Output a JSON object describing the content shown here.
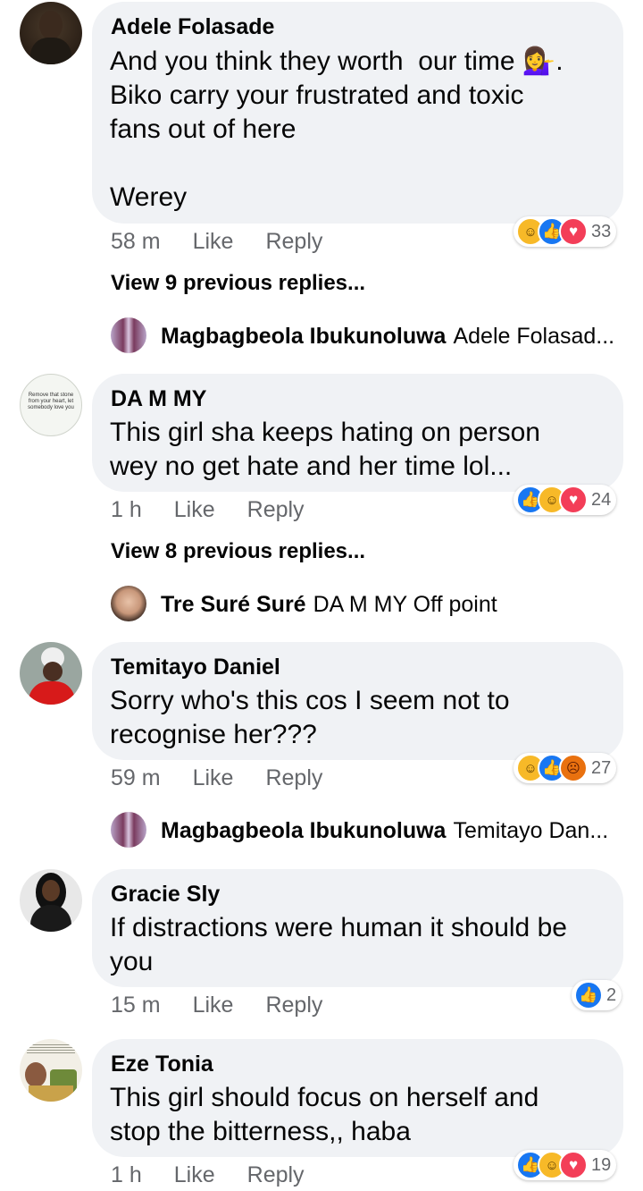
{
  "actions": {
    "like": "Like",
    "reply": "Reply"
  },
  "comments": [
    {
      "name": "Adele Folasade",
      "text": "And you think they worth  our time 💁‍♀️.\nBiko carry your frustrated and toxic\nfans out of here\n\nWerey",
      "time": "58 m",
      "reaction_count": "33",
      "reactions": [
        "haha-icon",
        "like-icon",
        "love-icon"
      ],
      "view_replies": "View 9 previous replies...",
      "reply_preview": {
        "name": "Magbagbeola Ibukunoluwa",
        "text": "Adele Folasad..."
      }
    },
    {
      "name": "DA M MY",
      "avatar_text": "Remove that stone from your heart, let somebody love you",
      "text": "This girl sha keeps hating on person\nwey no get hate and her time lol...",
      "time": "1 h",
      "reaction_count": "24",
      "reactions": [
        "like-icon",
        "haha-icon",
        "love-icon"
      ],
      "view_replies": "View 8 previous replies...",
      "reply_preview": {
        "name": "Tre Suré Suré",
        "text": "DA M MY Off point"
      }
    },
    {
      "name": "Temitayo Daniel",
      "text": "Sorry who's this cos I seem not to\nrecognise her???",
      "time": "59 m",
      "reaction_count": "27",
      "reactions": [
        "haha-icon",
        "like-icon",
        "angry-icon"
      ],
      "reply_preview": {
        "name": "Magbagbeola Ibukunoluwa",
        "text": "Temitayo Dan..."
      }
    },
    {
      "name": "Gracie Sly",
      "text": "If distractions were human it should be\nyou",
      "time": "15 m",
      "reaction_count": "2",
      "reactions": [
        "like-icon"
      ]
    },
    {
      "name": "Eze Tonia",
      "text": "This girl should focus on herself and\nstop the bitterness,, haba",
      "time": "1 h",
      "reaction_count": "19",
      "reactions": [
        "like-icon",
        "haha-icon",
        "love-icon"
      ]
    }
  ]
}
